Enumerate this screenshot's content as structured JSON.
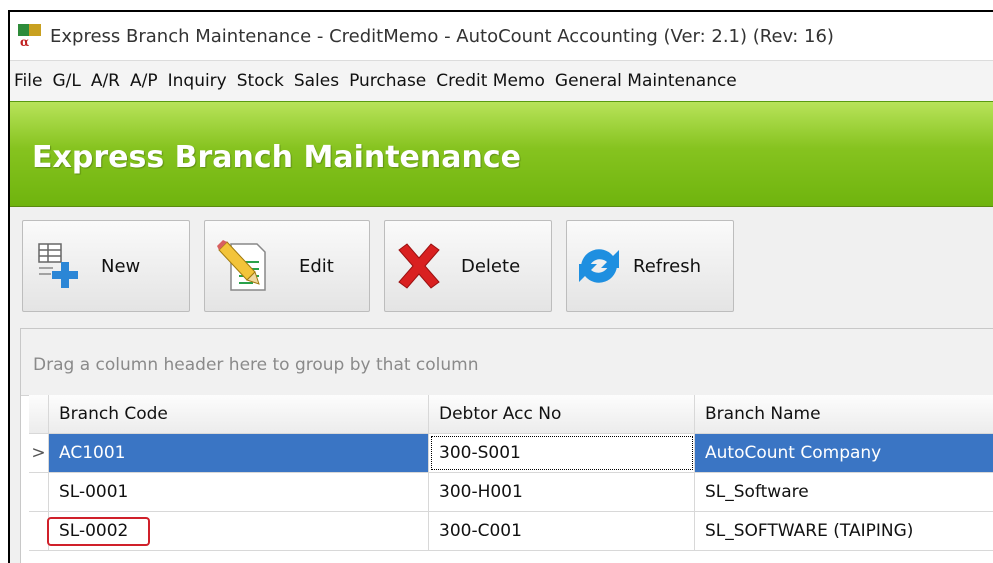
{
  "window": {
    "title": "Express Branch Maintenance - CreditMemo - AutoCount Accounting (Ver: 2.1) (Rev: 16)"
  },
  "menu": [
    "File",
    "G/L",
    "A/R",
    "A/P",
    "Inquiry",
    "Stock",
    "Sales",
    "Purchase",
    "Credit Memo",
    "General Maintenance"
  ],
  "banner": {
    "title": "Express Branch Maintenance"
  },
  "toolbar": {
    "new_label": "New",
    "edit_label": "Edit",
    "delete_label": "Delete",
    "refresh_label": "Refresh"
  },
  "grid": {
    "group_hint": "Drag a column header here to group by that column",
    "columns": [
      "Branch Code",
      "Debtor Acc No",
      "Branch Name"
    ],
    "rows": [
      {
        "indicator": ">",
        "branch_code": "AC1001",
        "debtor_acc_no": "300-S001",
        "branch_name": "AutoCount Company"
      },
      {
        "indicator": "",
        "branch_code": "SL-0001",
        "debtor_acc_no": "300-H001",
        "branch_name": "SL_Software"
      },
      {
        "indicator": "",
        "branch_code": "SL-0002",
        "debtor_acc_no": "300-C001",
        "branch_name": "SL_SOFTWARE (TAIPING)"
      }
    ]
  },
  "colors": {
    "banner_green": "#86c31f",
    "selection_blue": "#3a75c4",
    "highlight_red": "#d0202a"
  }
}
